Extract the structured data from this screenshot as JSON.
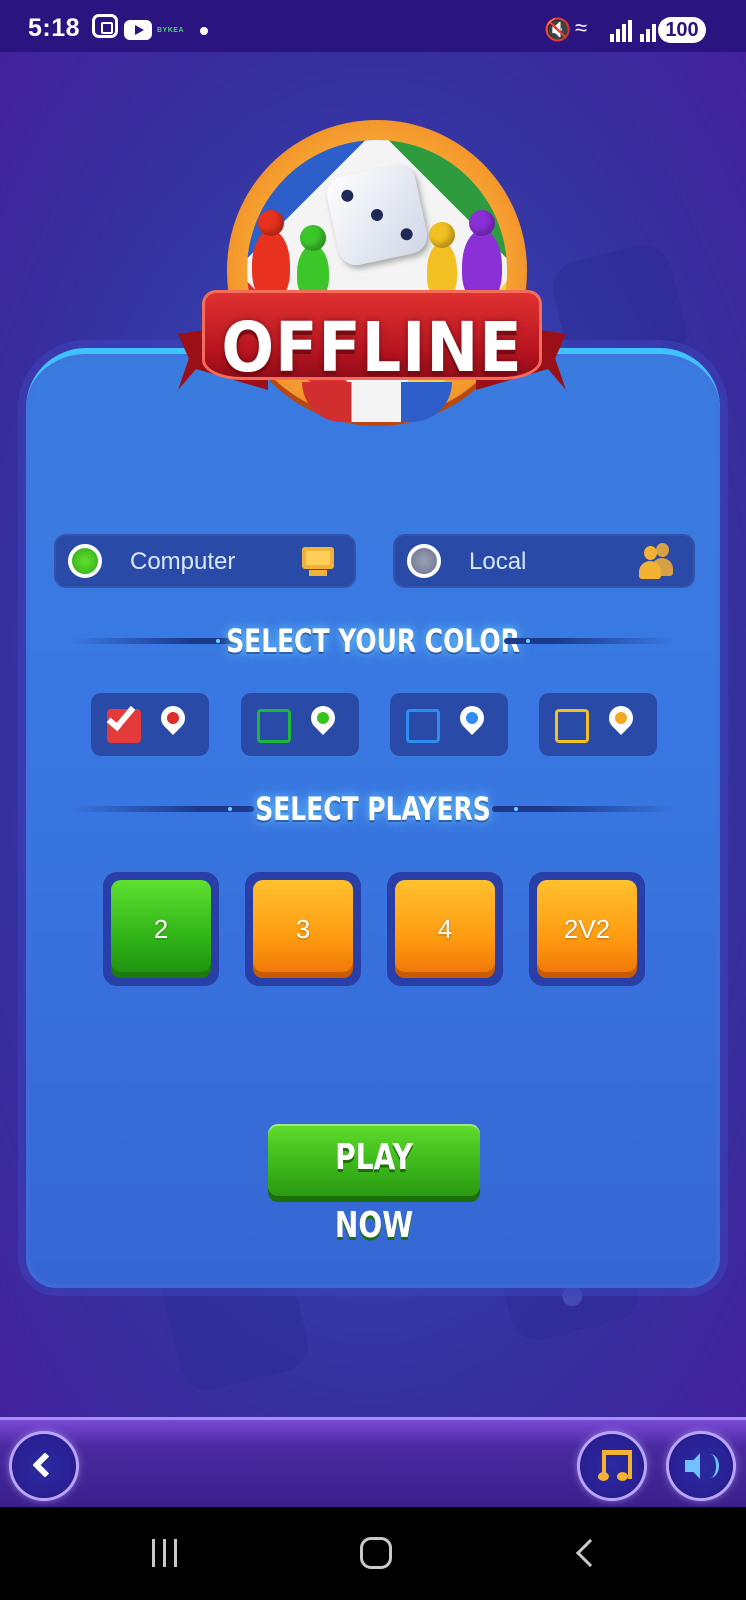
{
  "status_bar": {
    "time": "5:18",
    "bykea_label": "BYKEA",
    "battery": "100",
    "icons": [
      "screenshot-icon",
      "youtube-icon",
      "notification-dot",
      "mute-icon",
      "wifi-icon",
      "signal-icon",
      "signal-icon",
      "battery-icon"
    ]
  },
  "logo": {
    "title": "OFFLINE"
  },
  "mode": {
    "options": [
      {
        "label": "Computer",
        "selected": true,
        "icon": "monitor-icon"
      },
      {
        "label": "Local",
        "selected": false,
        "icon": "users-icon"
      }
    ]
  },
  "colors": {
    "heading": "SELECT YOUR COLOR",
    "options": [
      {
        "name": "red",
        "hex": "#e33a3a",
        "checked": true
      },
      {
        "name": "green",
        "hex": "#1db83a",
        "checked": false
      },
      {
        "name": "blue",
        "hex": "#2f8cf0",
        "checked": false
      },
      {
        "name": "yellow",
        "hex": "#f2c022",
        "checked": false
      }
    ]
  },
  "players": {
    "heading": "SELECT PLAYERS",
    "options": [
      {
        "label": "2",
        "selected": true
      },
      {
        "label": "3",
        "selected": false
      },
      {
        "label": "4",
        "selected": false
      },
      {
        "label": "2V2",
        "selected": false
      }
    ]
  },
  "play_button": {
    "label": "PLAY NOW"
  },
  "bottom_bar": {
    "icons": [
      "back-icon",
      "music-icon",
      "sound-icon"
    ]
  },
  "theme": {
    "accent_green": "#3cb81c",
    "accent_orange": "#ff9a10",
    "panel_blue": "#3978e2"
  }
}
